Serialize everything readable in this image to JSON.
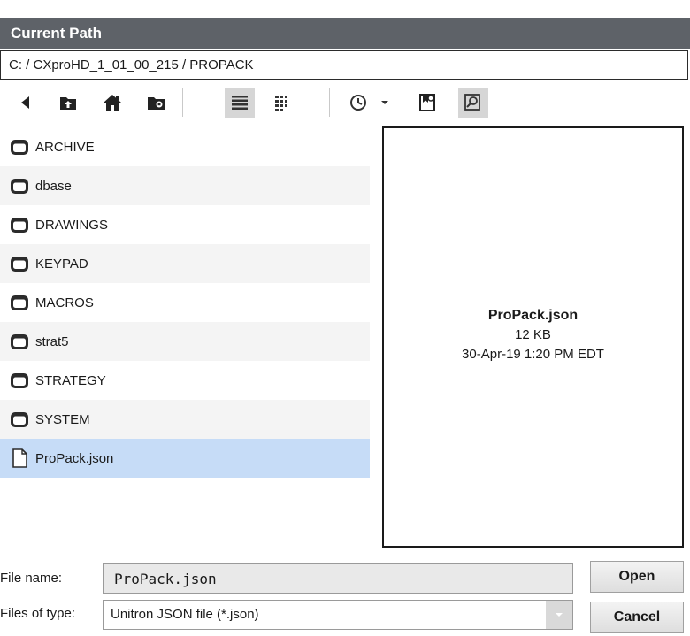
{
  "header": {
    "title": "Current Path"
  },
  "path": {
    "value": "C: / CXproHD_1_01_00_215 / PROPACK"
  },
  "toolbar": {
    "icons": [
      "back-arrow-icon",
      "folder-up-icon",
      "home-icon",
      "new-folder-icon",
      "list-view-icon",
      "details-view-icon",
      "history-icon",
      "dropdown-caret-icon",
      "bookmark-icon",
      "preview-icon"
    ],
    "active": [
      "list-view-icon",
      "preview-icon"
    ]
  },
  "files": [
    {
      "name": "ARCHIVE",
      "type": "folder"
    },
    {
      "name": "dbase",
      "type": "folder"
    },
    {
      "name": "DRAWINGS",
      "type": "folder"
    },
    {
      "name": "KEYPAD",
      "type": "folder"
    },
    {
      "name": "MACROS",
      "type": "folder"
    },
    {
      "name": "strat5",
      "type": "folder"
    },
    {
      "name": "STRATEGY",
      "type": "folder"
    },
    {
      "name": "SYSTEM",
      "type": "folder"
    },
    {
      "name": "ProPack.json",
      "type": "file",
      "selected": true
    }
  ],
  "preview": {
    "name": "ProPack.json",
    "size": "12 KB",
    "date": "30-Apr-19 1:20 PM EDT"
  },
  "form": {
    "file_name_label": "File name:",
    "file_name_value": "ProPack.json",
    "file_type_label": "Files of type:",
    "file_type_value": "Unitron JSON file (*.json)"
  },
  "buttons": {
    "open": "Open",
    "cancel": "Cancel"
  }
}
